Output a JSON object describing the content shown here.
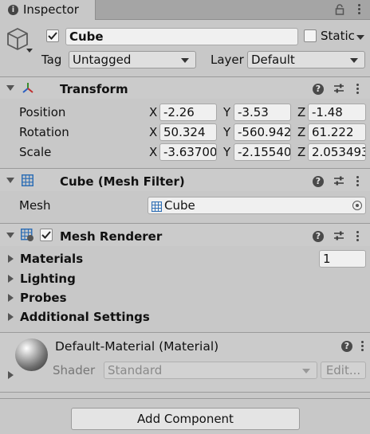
{
  "tab": {
    "title": "Inspector"
  },
  "object": {
    "name": "Cube",
    "static_label": "Static",
    "tag_label": "Tag",
    "tag_value": "Untagged",
    "layer_label": "Layer",
    "layer_value": "Default"
  },
  "transform": {
    "title": "Transform",
    "rows": [
      {
        "label": "Position",
        "x": "-2.26",
        "y": "-3.53",
        "z": "-1.48"
      },
      {
        "label": "Rotation",
        "x": "50.324",
        "y": "-560.942",
        "z": "61.222"
      },
      {
        "label": "Scale",
        "x": "-3.63700",
        "y": "-2.15540",
        "z": "2.053493"
      }
    ],
    "axis_x": "X",
    "axis_y": "Y",
    "axis_z": "Z"
  },
  "mesh_filter": {
    "title": "Cube (Mesh Filter)",
    "mesh_label": "Mesh",
    "mesh_value": "Cube"
  },
  "mesh_renderer": {
    "title": "Mesh Renderer",
    "materials_label": "Materials",
    "materials_count": "1",
    "lighting_label": "Lighting",
    "probes_label": "Probes",
    "additional_label": "Additional Settings"
  },
  "material": {
    "title": "Default-Material (Material)",
    "shader_label": "Shader",
    "shader_value": "Standard",
    "edit_label": "Edit..."
  },
  "footer": {
    "add_component_label": "Add Component"
  }
}
